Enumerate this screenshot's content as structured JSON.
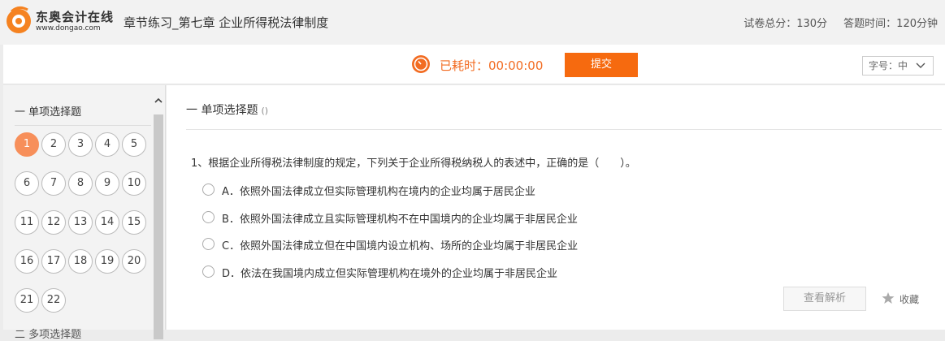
{
  "header": {
    "logo_cn": "东奥会计在线",
    "logo_url": "www.dongao.com",
    "title": "章节练习_第七章 企业所得税法律制度",
    "total_score": "试卷总分：130分",
    "duration": "答题时间：120分钟"
  },
  "toolbar": {
    "timer_label": "已耗时：00:00:00",
    "submit_label": "提交",
    "font_size_label": "字号：中"
  },
  "sidebar": {
    "section_label": "一 单项选择题",
    "next_section_label": "二 多项选择题",
    "questions": [
      "1",
      "2",
      "3",
      "4",
      "5",
      "6",
      "7",
      "8",
      "9",
      "10",
      "11",
      "12",
      "13",
      "14",
      "15",
      "16",
      "17",
      "18",
      "19",
      "20",
      "21",
      "22"
    ],
    "active_question": "1"
  },
  "main": {
    "section_title": "一 单项选择题",
    "section_sub": "()",
    "question_text": "1、根据企业所得税法律制度的规定，下列关于企业所得税纳税人的表述中，正确的是（　　）。",
    "options": [
      "A．依照外国法律成立但实际管理机构在境内的企业均属于居民企业",
      "B．依照外国法律成立且实际管理机构不在中国境内的企业均属于非居民企业",
      "C．依照外国法律成立但在中国境内设立机构、场所的企业均属于非居民企业",
      "D．依法在我国境内成立但实际管理机构在境外的企业均属于非居民企业"
    ],
    "analysis_label": "查看解析",
    "favorite_label": "收藏"
  },
  "colors": {
    "accent": "#f66a0f",
    "active_question": "#f78f5a",
    "timer": "#f26c22"
  }
}
